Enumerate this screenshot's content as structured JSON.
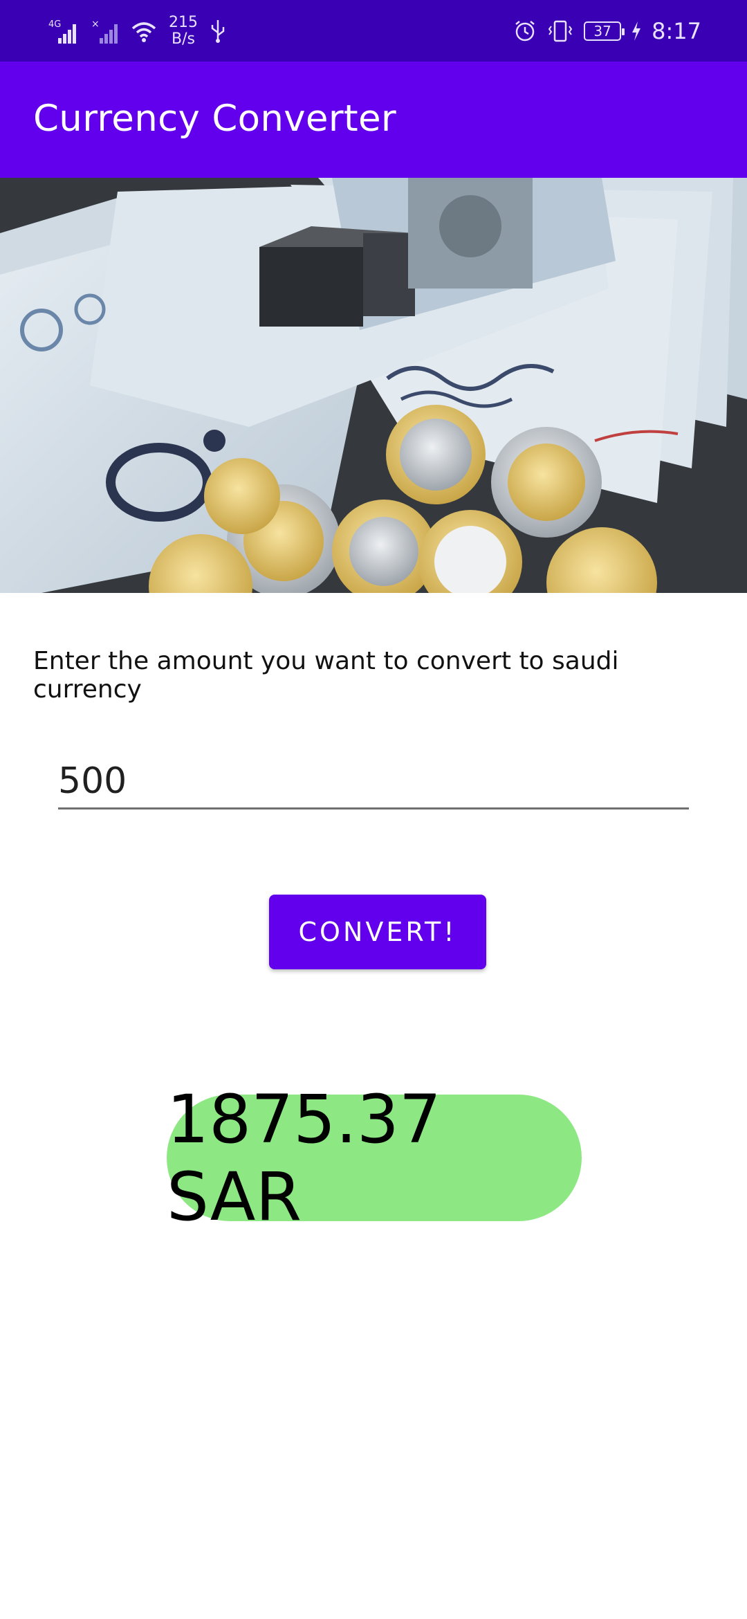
{
  "status_bar": {
    "network_type": "4G",
    "net_speed_value": "215",
    "net_speed_unit": "B/s",
    "battery": "37",
    "time": "8:17"
  },
  "app_bar": {
    "title": "Currency Converter"
  },
  "banner": {
    "icon": "saudi-riyal-banknotes-and-coins-image"
  },
  "converter": {
    "prompt": "Enter the amount you want to convert to saudi currency",
    "amount_value": "500",
    "convert_label": "CONVERT!",
    "result": "1875.37 SAR"
  },
  "colors": {
    "status_bar": "#3a00b3",
    "primary": "#6200ee",
    "result_bg": "#8de884"
  }
}
